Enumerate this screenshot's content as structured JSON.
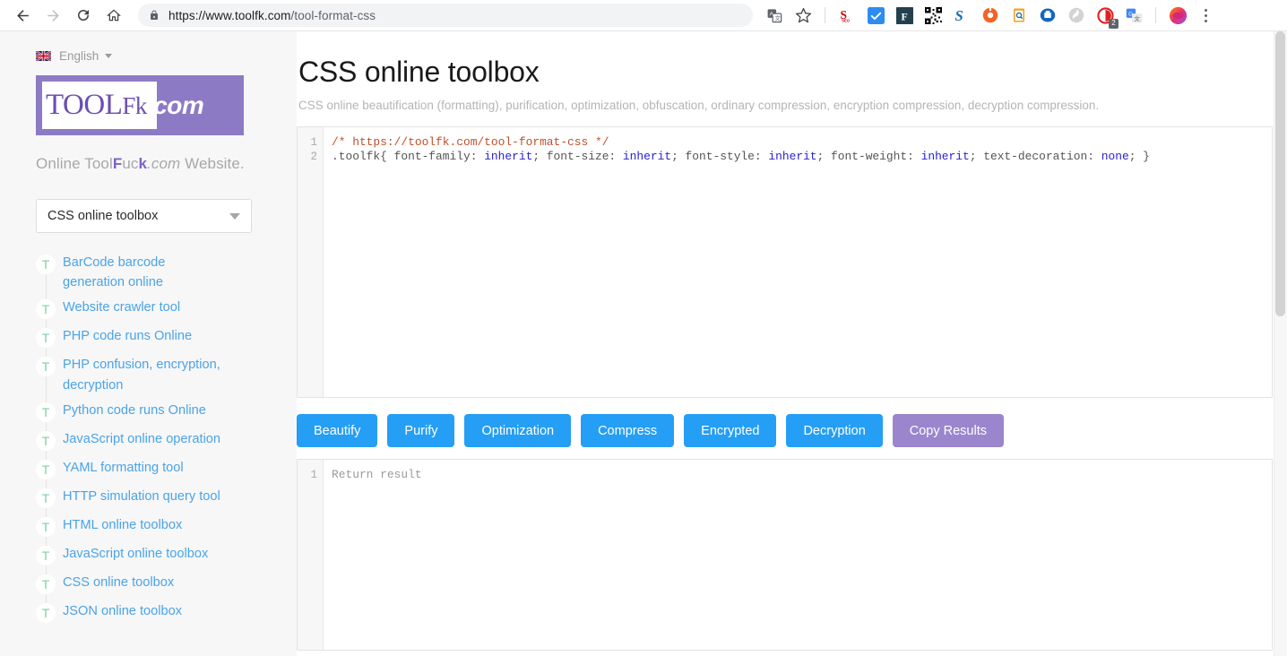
{
  "browser": {
    "back_icon": "back-arrow-icon",
    "forward_icon": "forward-arrow-icon",
    "reload_icon": "reload-icon",
    "home_icon": "home-icon",
    "lock_icon": "lock-icon",
    "url_origin": "https://www.toolfk.com",
    "url_path": "/tool-format-css",
    "translate_icon": "translate-icon",
    "bookmark_icon": "star-bookmark-icon",
    "extensions": [
      {
        "name": "seo-extension-icon",
        "label": "S"
      },
      {
        "name": "checkmark-extension-icon",
        "label": "✓"
      },
      {
        "name": "fonts-extension-icon",
        "label": "F"
      },
      {
        "name": "qr-code-extension-icon",
        "label": ""
      },
      {
        "name": "s-extension-icon",
        "label": "S"
      },
      {
        "name": "orange-circle-extension-icon",
        "label": ""
      },
      {
        "name": "clipboard-search-extension-icon",
        "label": ""
      },
      {
        "name": "printer-extension-icon",
        "label": ""
      },
      {
        "name": "gray-swirl-extension-icon",
        "label": ""
      },
      {
        "name": "red-circle-extension-icon",
        "label": "",
        "badge": "2"
      },
      {
        "name": "google-translate-extension-icon",
        "label": ""
      }
    ],
    "profile_icon": "profile-avatar-icon",
    "menu_icon": "chrome-menu-icon"
  },
  "sidebar": {
    "language": {
      "flag_icon": "uk-flag-icon",
      "label": "English",
      "caret_icon": "chevron-down-icon"
    },
    "logo": {
      "part1": "TOOL",
      "part2": "F",
      "part3": "k",
      "part4": ".com"
    },
    "tagline": {
      "pre": "Online Tool",
      "bold1": "F",
      "mid": "uc",
      "bold2": "k",
      "italic": ".com",
      "post": " Website."
    },
    "select": {
      "value": "CSS online toolbox",
      "caret_icon": "chevron-down-icon"
    },
    "menu_icon_letter": "T",
    "items": [
      {
        "label": "BarCode barcode generation online"
      },
      {
        "label": "Website crawler tool"
      },
      {
        "label": "PHP code runs Online"
      },
      {
        "label": "PHP confusion, encryption, decryption"
      },
      {
        "label": "Python code runs Online"
      },
      {
        "label": "JavaScript online operation"
      },
      {
        "label": "YAML formatting tool"
      },
      {
        "label": "HTTP simulation query tool"
      },
      {
        "label": "HTML online toolbox"
      },
      {
        "label": "JavaScript online toolbox"
      },
      {
        "label": "CSS online toolbox"
      },
      {
        "label": "JSON online toolbox"
      }
    ]
  },
  "main": {
    "title": "CSS online toolbox",
    "subtitle": "CSS online beautification (formatting), purification, optimization, obfuscation, ordinary compression, encryption compression, decryption compression.",
    "input_editor": {
      "line_numbers": [
        "1",
        "2"
      ],
      "line1_comment": "/* https://toolfk.com/tool-format-css */",
      "line2": {
        "selector": ".toolfk{ font-family: ",
        "v1": "inherit",
        "s1": "; font-size: ",
        "v2": "inherit",
        "s2": "; font-style: ",
        "v3": "inherit",
        "s3": "; font-weight: ",
        "v4": "inherit",
        "s4": "; text-decoration: ",
        "v5": "none",
        "s5": "; }"
      }
    },
    "buttons": [
      {
        "label": "Beautify",
        "name": "beautify-button",
        "style": "blue"
      },
      {
        "label": "Purify",
        "name": "purify-button",
        "style": "blue"
      },
      {
        "label": "Optimization",
        "name": "optimization-button",
        "style": "blue"
      },
      {
        "label": "Compress",
        "name": "compress-button",
        "style": "blue"
      },
      {
        "label": "Encrypted",
        "name": "encrypted-button",
        "style": "blue"
      },
      {
        "label": "Decryption",
        "name": "decryption-button",
        "style": "blue"
      },
      {
        "label": "Copy Results",
        "name": "copy-results-button",
        "style": "purple"
      }
    ],
    "output_editor": {
      "line_number": "1",
      "placeholder": "Return result"
    }
  },
  "colors": {
    "primary_blue": "#259ef5",
    "purple": "#9b85cd",
    "logo_purple": "#8d7ac4",
    "link_blue": "#4aa3e8",
    "badge_green": "#7ed0a0",
    "sidebar_bg": "#f7f7f7"
  }
}
